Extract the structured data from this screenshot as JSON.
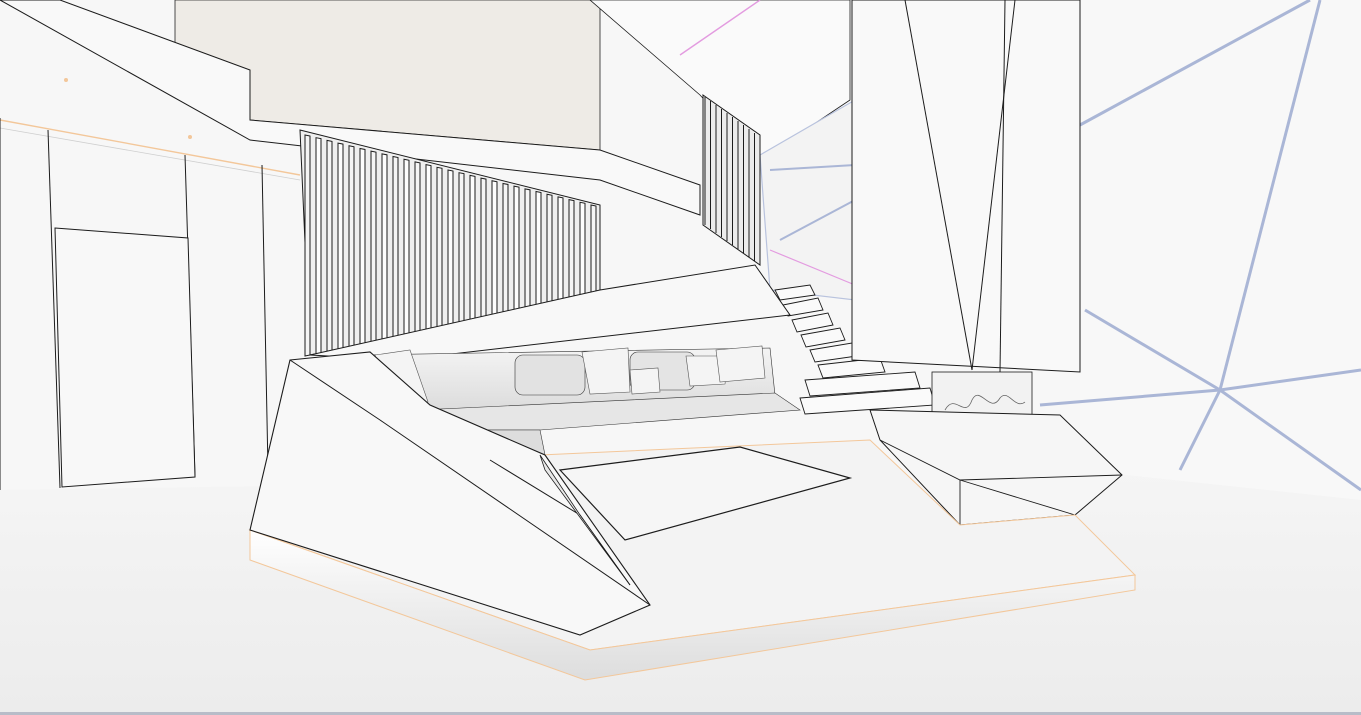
{
  "scene": {
    "subject": "interior-render",
    "palette": {
      "background": "#f4f4f4",
      "floor": "#f2f2f2",
      "wall": "#f7f7f7",
      "panel_shade": "#e6e6e6",
      "glass": "#eceae6",
      "line": "#1c1c1c",
      "accent_edge": "#f3c79a",
      "accent_blue": "#aab6d6",
      "accent_pink": "#e39be0"
    },
    "icons": []
  }
}
